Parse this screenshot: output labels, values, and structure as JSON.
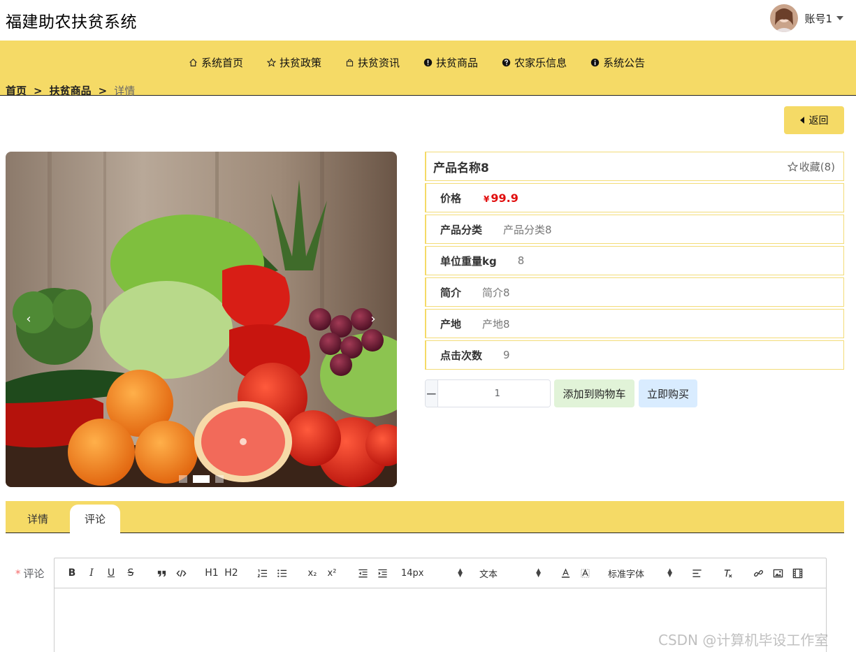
{
  "header": {
    "site_title": "福建助农扶贫系统",
    "username": "账号1"
  },
  "menu": [
    {
      "label": "系统首页",
      "icon": "home-icon"
    },
    {
      "label": "扶贫政策",
      "icon": "star-icon"
    },
    {
      "label": "扶贫资讯",
      "icon": "bag-icon"
    },
    {
      "label": "扶贫商品",
      "icon": "exclamation-icon"
    },
    {
      "label": "农家乐信息",
      "icon": "question-icon"
    },
    {
      "label": "系统公告",
      "icon": "info-icon"
    }
  ],
  "breadcrumb": {
    "home": "首页",
    "category": "扶贫商品",
    "current": "详情",
    "separator": ">"
  },
  "back_button": "返回",
  "carousel": {
    "prev": "‹",
    "next": "›",
    "active_index": 1,
    "count": 3
  },
  "product": {
    "name": "产品名称8",
    "favorite": "收藏(8)",
    "price_label": "价格",
    "currency": "¥",
    "price": "99.9",
    "category_label": "产品分类",
    "category": "产品分类8",
    "weight_label": "单位重量kg",
    "weight": "8",
    "intro_label": "简介",
    "intro": "简介8",
    "origin_label": "产地",
    "origin": "产地8",
    "clicks_label": "点击次数",
    "clicks": "9"
  },
  "quantity": {
    "minus": "−",
    "plus": "+",
    "value": "1"
  },
  "actions": {
    "add_to_cart": "添加到购物车",
    "buy_now": "立即购买"
  },
  "tabs": [
    {
      "label": "详情"
    },
    {
      "label": "评论"
    }
  ],
  "comment": {
    "required_mark": "*",
    "label": "评论",
    "editor": {
      "bold": "B",
      "italic": "I",
      "underline": "U",
      "strike": "S",
      "h1": "H1",
      "h2": "H2",
      "sub": "x₂",
      "sup": "x²",
      "size": "14px",
      "header": "文本",
      "font": "标准字体"
    }
  },
  "watermark": "CSDN @计算机毕设工作室",
  "colors": {
    "accent": "#f5da66",
    "price": "#e10e0e",
    "cart_bg": "#e1f3d8",
    "buy_bg": "#d9ecff"
  }
}
